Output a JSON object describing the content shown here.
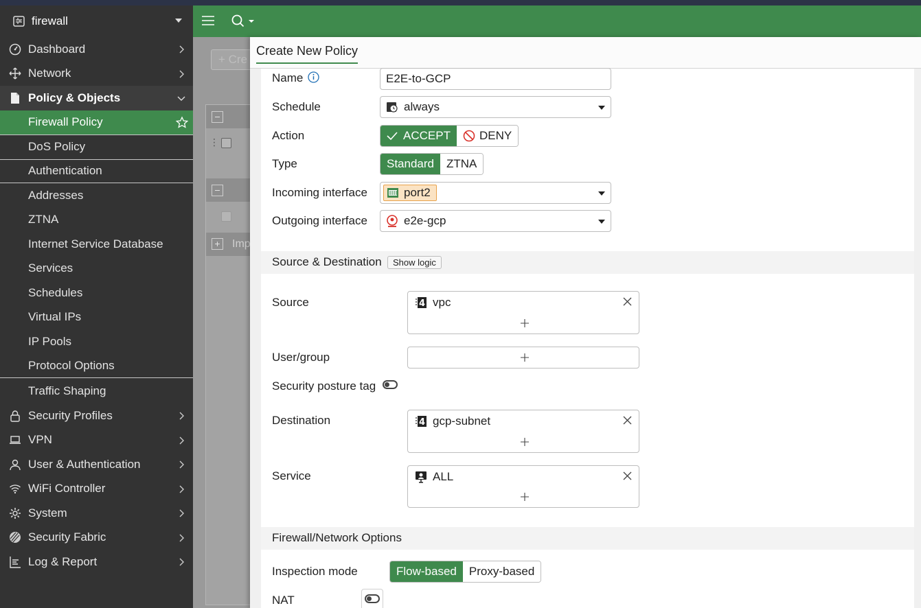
{
  "sidebar": {
    "device": "firewall",
    "items": [
      {
        "label": "Dashboard",
        "icon": "dashboard-icon"
      },
      {
        "label": "Network",
        "icon": "network-icon"
      },
      {
        "label": "Policy & Objects",
        "icon": "policy-icon"
      },
      {
        "label": "Security Profiles",
        "icon": "lock-icon"
      },
      {
        "label": "VPN",
        "icon": "laptop-icon"
      },
      {
        "label": "User & Authentication",
        "icon": "user-icon"
      },
      {
        "label": "WiFi Controller",
        "icon": "wifi-icon"
      },
      {
        "label": "System",
        "icon": "gear-icon"
      },
      {
        "label": "Security Fabric",
        "icon": "fabric-icon"
      },
      {
        "label": "Log & Report",
        "icon": "report-icon"
      }
    ],
    "policy_sub": [
      "Firewall Policy",
      "DoS Policy",
      "Authentication",
      "Addresses",
      "ZTNA",
      "Internet Service Database",
      "Services",
      "Schedules",
      "Virtual IPs",
      "IP Pools",
      "Protocol Options",
      "Traffic Shaping"
    ]
  },
  "background": {
    "create_label": "Cre",
    "import_label": "Imp"
  },
  "panel": {
    "title": "Create New Policy",
    "name_label": "Name",
    "name_value": "E2E-to-GCP",
    "schedule_label": "Schedule",
    "schedule_value": "always",
    "action_label": "Action",
    "action_accept": "ACCEPT",
    "action_deny": "DENY",
    "type_label": "Type",
    "type_standard": "Standard",
    "type_ztna": "ZTNA",
    "incoming_label": "Incoming interface",
    "incoming_value": "port2",
    "outgoing_label": "Outgoing interface",
    "outgoing_value": "e2e-gcp",
    "section_src_dst": "Source & Destination",
    "show_logic": "Show logic",
    "source_label": "Source",
    "source_value": "vpc",
    "usergroup_label": "User/group",
    "posture_label": "Security posture tag",
    "destination_label": "Destination",
    "destination_value": "gcp-subnet",
    "service_label": "Service",
    "service_value": "ALL",
    "section_fw_options": "Firewall/Network Options",
    "inspection_label": "Inspection mode",
    "inspection_flow": "Flow-based",
    "inspection_proxy": "Proxy-based",
    "nat_label": "NAT"
  },
  "colors": {
    "brand_green": "#3f8a4d",
    "sidebar_bg": "#333333",
    "deny_red": "#d9322b",
    "port_tag_bg": "#fbe3c3"
  }
}
